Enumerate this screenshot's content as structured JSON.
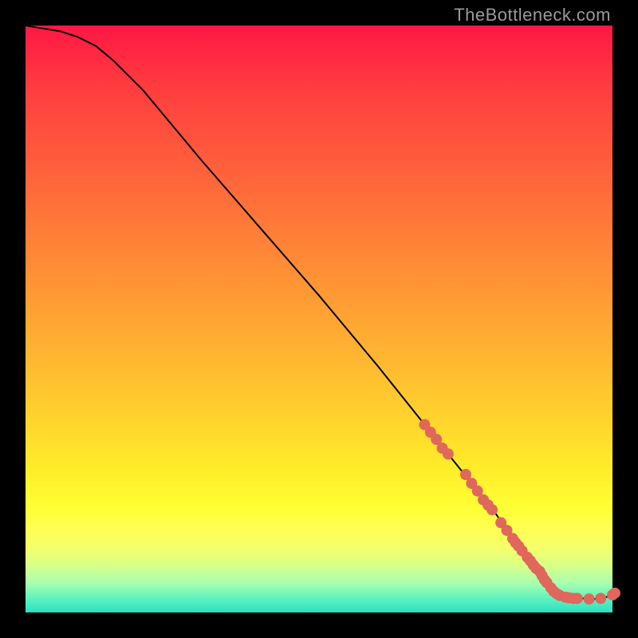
{
  "watermark": "TheBottleneck.com",
  "colors": {
    "frame": "#000000",
    "line": "#000000",
    "marker": "#e0675b"
  },
  "chart_data": {
    "type": "line",
    "title": "",
    "xlabel": "",
    "ylabel": "",
    "xlim": [
      0,
      100
    ],
    "ylim": [
      0,
      100
    ],
    "grid": false,
    "legend": false,
    "series": [
      {
        "name": "curve",
        "x": [
          0,
          3,
          6,
          9,
          12,
          15,
          20,
          30,
          40,
          50,
          60,
          68,
          72,
          76,
          80,
          82,
          84,
          86,
          88,
          90,
          92,
          94,
          96,
          98,
          100
        ],
        "y": [
          100,
          99.5,
          99,
          98,
          96.5,
          94,
          89,
          77,
          65.5,
          54,
          42,
          32,
          27,
          22,
          17,
          14,
          11.5,
          9,
          6.5,
          4.5,
          3,
          2.5,
          2.3,
          2.3,
          3
        ]
      }
    ],
    "markers": [
      {
        "x": 68,
        "y": 32
      },
      {
        "x": 69,
        "y": 30.7
      },
      {
        "x": 70,
        "y": 29.5
      },
      {
        "x": 71,
        "y": 28
      },
      {
        "x": 72,
        "y": 27
      },
      {
        "x": 75,
        "y": 23.5
      },
      {
        "x": 76,
        "y": 22
      },
      {
        "x": 77,
        "y": 20.7
      },
      {
        "x": 78,
        "y": 19.2
      },
      {
        "x": 78.8,
        "y": 18.3
      },
      {
        "x": 79.5,
        "y": 17.5
      },
      {
        "x": 81,
        "y": 15.3
      },
      {
        "x": 82,
        "y": 14
      },
      {
        "x": 83,
        "y": 12.6
      },
      {
        "x": 83.5,
        "y": 11.9
      },
      {
        "x": 84,
        "y": 11.3
      },
      {
        "x": 84.6,
        "y": 10.5
      },
      {
        "x": 85.5,
        "y": 9.4
      },
      {
        "x": 86,
        "y": 8.8
      },
      {
        "x": 86.5,
        "y": 8.1
      },
      {
        "x": 87,
        "y": 7.5
      },
      {
        "x": 87.6,
        "y": 7
      },
      {
        "x": 88,
        "y": 6.3
      },
      {
        "x": 88.4,
        "y": 5.6
      },
      {
        "x": 88.8,
        "y": 5.1
      },
      {
        "x": 89.5,
        "y": 4.2
      },
      {
        "x": 90,
        "y": 3.6
      },
      {
        "x": 90.5,
        "y": 3.2
      },
      {
        "x": 91,
        "y": 2.9
      },
      {
        "x": 92,
        "y": 2.6
      },
      {
        "x": 92.6,
        "y": 2.5
      },
      {
        "x": 93.3,
        "y": 2.4
      },
      {
        "x": 94,
        "y": 2.4
      },
      {
        "x": 96,
        "y": 2.3
      },
      {
        "x": 98,
        "y": 2.4
      },
      {
        "x": 100,
        "y": 3
      },
      {
        "x": 100.4,
        "y": 3.3
      }
    ]
  }
}
